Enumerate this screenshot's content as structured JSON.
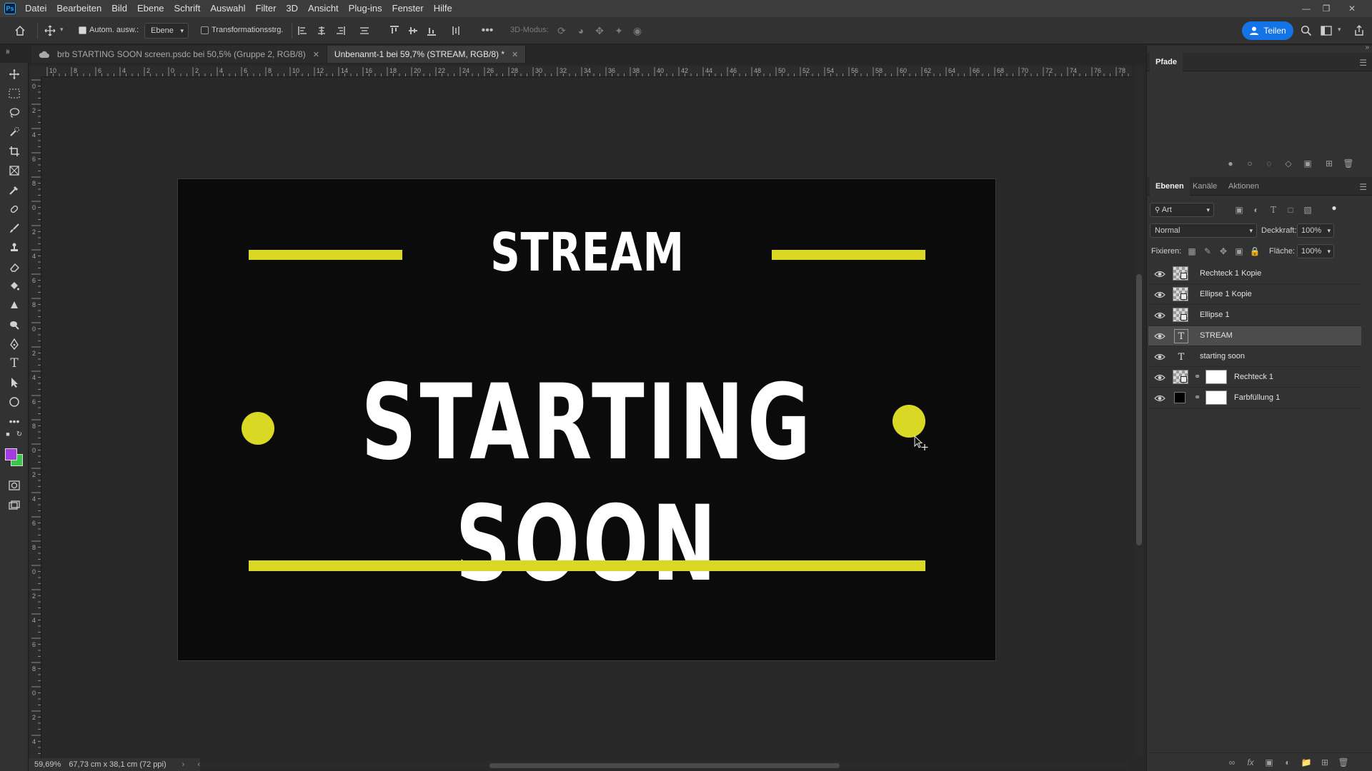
{
  "menu": {
    "items": [
      "Datei",
      "Bearbeiten",
      "Bild",
      "Ebene",
      "Schrift",
      "Auswahl",
      "Filter",
      "3D",
      "Ansicht",
      "Plug-ins",
      "Fenster",
      "Hilfe"
    ]
  },
  "options": {
    "auto_select_label": "Autom. ausw.:",
    "auto_select_value": "Ebene",
    "transform_controls_label": "Transformationsstrg.",
    "mode_3d_label": "3D-Modus:",
    "share_label": "Teilen"
  },
  "tabs": [
    {
      "label": "brb STARTING SOON screen.psdc bei 50,5% (Gruppe 2, RGB/8)"
    },
    {
      "label": "Unbenannt-1 bei 59,7% (STREAM, RGB/8) *"
    }
  ],
  "ruler_h_labels": [
    "10",
    "8",
    "6",
    "4",
    "2",
    "0",
    "2",
    "4",
    "6",
    "8",
    "10",
    "12",
    "14",
    "16",
    "18",
    "20",
    "22",
    "24",
    "26",
    "28",
    "30",
    "32",
    "34",
    "36",
    "38",
    "40",
    "42",
    "44",
    "46",
    "48",
    "50",
    "52",
    "54",
    "56",
    "58",
    "60",
    "62",
    "64",
    "66",
    "68",
    "70",
    "72",
    "74",
    "76",
    "78"
  ],
  "ruler_v_labels": [
    "0",
    "2",
    "4",
    "6",
    "8",
    "0",
    "2",
    "4",
    "6",
    "8",
    "0",
    "2",
    "4",
    "6",
    "8",
    "0",
    "2",
    "4",
    "6",
    "8",
    "0",
    "2",
    "4",
    "6",
    "8",
    "0",
    "2",
    "4",
    "6",
    "8"
  ],
  "canvas": {
    "title_small": "STREAM",
    "title_big": "STARTING SOON",
    "accent_color": "#d9d824"
  },
  "status": {
    "zoom": "59,69%",
    "doc_size": "67,73 cm x 38,1 cm (72 ppi)"
  },
  "panels": {
    "paths_title": "Pfade",
    "layer_tabs": [
      "Ebenen",
      "Kanäle",
      "Aktionen"
    ],
    "filter_kind": "Art",
    "blend_mode": "Normal",
    "opacity_label": "Deckkraft:",
    "opacity_value": "100%",
    "lock_label": "Fixieren:",
    "fill_label": "Fläche:",
    "fill_value": "100%"
  },
  "layers": [
    {
      "name": "Rechteck 1 Kopie",
      "kind": "shape",
      "selected": false
    },
    {
      "name": "Ellipse 1 Kopie",
      "kind": "shape",
      "selected": false
    },
    {
      "name": "Ellipse 1",
      "kind": "shape",
      "selected": false
    },
    {
      "name": "STREAM",
      "kind": "text",
      "selected": true
    },
    {
      "name": "starting soon",
      "kind": "text",
      "selected": false
    },
    {
      "name": "Rechteck 1",
      "kind": "shape-mask",
      "selected": false
    },
    {
      "name": "Farbfüllung 1",
      "kind": "fill",
      "selected": false
    }
  ]
}
